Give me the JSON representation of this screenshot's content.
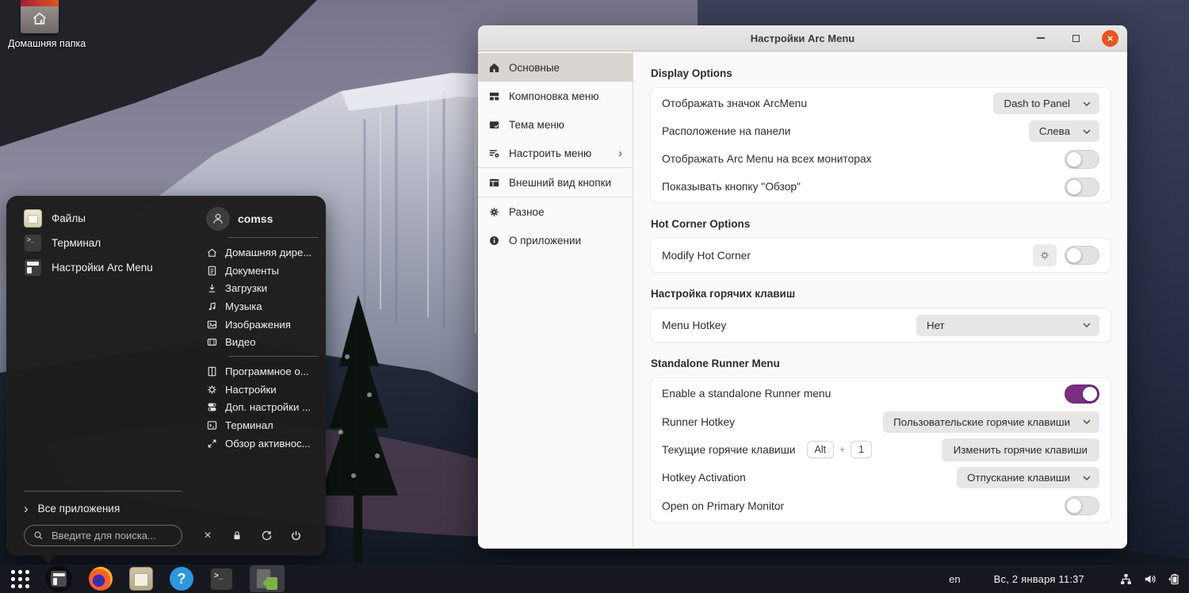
{
  "colors": {
    "accent_orange": "#e9541f",
    "toggle_on": "#7b2f82"
  },
  "desktop": {
    "home_icon_label": "Домашняя папка"
  },
  "arc_menu": {
    "pinned": [
      {
        "label": "Файлы"
      },
      {
        "label": "Терминал"
      },
      {
        "label": "Настройки Arc Menu"
      }
    ],
    "user": {
      "name": "comss"
    },
    "places": [
      {
        "label": "Домашняя дире..."
      },
      {
        "label": "Документы"
      },
      {
        "label": "Загрузки"
      },
      {
        "label": "Музыка"
      },
      {
        "label": "Изображения"
      },
      {
        "label": "Видео"
      }
    ],
    "shortcuts": [
      {
        "label": "Программное о..."
      },
      {
        "label": "Настройки"
      },
      {
        "label": "Доп. настройки ..."
      },
      {
        "label": "Терминал"
      },
      {
        "label": "Обзор активнос..."
      }
    ],
    "all_apps_label": "Все приложения",
    "search_placeholder": "Введите для поиска..."
  },
  "window": {
    "title": "Настройки Arc Menu",
    "sidebar": [
      {
        "label": "Основные"
      },
      {
        "label": "Компоновка меню"
      },
      {
        "label": "Тема меню"
      },
      {
        "label": "Настроить меню"
      },
      {
        "label": "Внешний вид кнопки"
      },
      {
        "label": "Разное"
      },
      {
        "label": "О приложении"
      }
    ],
    "display": {
      "title": "Display Options",
      "rows": [
        {
          "label": "Отображать значок ArcMenu",
          "value": "Dash to Panel"
        },
        {
          "label": "Расположение на панели",
          "value": "Слева"
        },
        {
          "label": "Отображать Arc Menu на всех мониторах",
          "toggle": "off"
        },
        {
          "label": "Показывать кнопку \"Обзор\"",
          "toggle": "off"
        }
      ]
    },
    "hot_corner": {
      "title": "Hot Corner Options",
      "rows": [
        {
          "label": "Modify Hot Corner",
          "toggle": "off"
        }
      ]
    },
    "hotkey": {
      "title": "Настройка горячих клавиш",
      "rows": [
        {
          "label": "Menu Hotkey",
          "value": "Нет"
        }
      ]
    },
    "runner": {
      "title": "Standalone Runner Menu",
      "rows": [
        {
          "label": "Enable a standalone Runner menu",
          "toggle": "on"
        },
        {
          "label": "Runner Hotkey",
          "value": "Пользовательские горячие клавиши"
        },
        {
          "label": "Текущие горячие клавиши",
          "key1": "Alt",
          "plus": "+",
          "key2": "1",
          "button": "Изменить горячие клавиши"
        },
        {
          "label": "Hotkey Activation",
          "value": "Отпускание клавиши"
        },
        {
          "label": "Open on Primary Monitor",
          "toggle": "off"
        }
      ]
    }
  },
  "taskbar": {
    "layout_indicator": "en",
    "clock": "Вс, 2 января 11:37"
  }
}
